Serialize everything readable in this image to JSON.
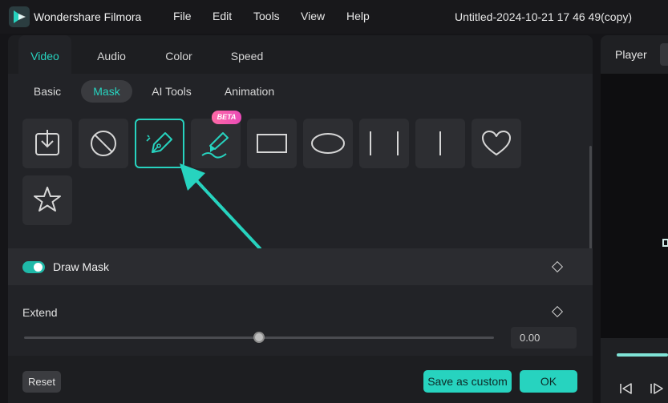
{
  "app": {
    "name": "Wondershare Filmora",
    "document_title": "Untitled-2024-10-21 17 46 49(copy)"
  },
  "menu": [
    "File",
    "Edit",
    "Tools",
    "View",
    "Help"
  ],
  "tabs": [
    "Video",
    "Audio",
    "Color",
    "Speed"
  ],
  "subtabs": [
    "Basic",
    "Mask",
    "AI Tools",
    "Animation"
  ],
  "mask_shapes": {
    "beta_label": "BETA",
    "items": [
      "import-mask",
      "no-mask",
      "draw-mask-pen",
      "ai-brush",
      "rectangle",
      "ellipse",
      "double-line",
      "single-line",
      "heart",
      "star"
    ],
    "selected": "draw-mask-pen"
  },
  "draw_mask": {
    "label": "Draw Mask",
    "enabled": true
  },
  "extend": {
    "label": "Extend",
    "value": "0.00",
    "slider_fraction": 0.5
  },
  "footer": {
    "reset": "Reset",
    "save_custom": "Save as custom",
    "ok": "OK"
  },
  "player": {
    "tab": "Player"
  },
  "colors": {
    "accent": "#27d3bf",
    "panel": "#222327",
    "badge": "#ff6aa6"
  }
}
